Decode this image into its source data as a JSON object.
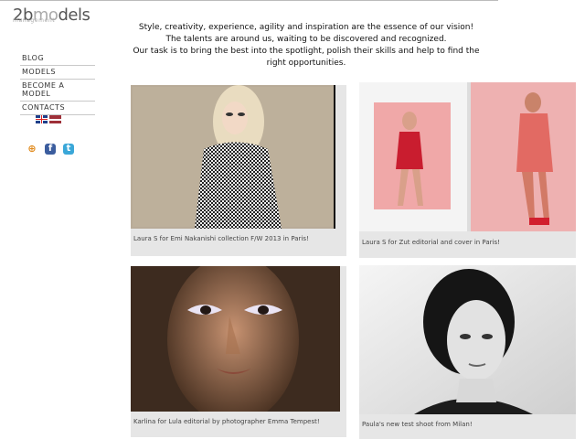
{
  "logo": {
    "part1": "2b",
    "part2": "mo",
    "part3": "dels",
    "sub": "management"
  },
  "nav": [
    {
      "label": "BLOG"
    },
    {
      "label": "MODELS"
    },
    {
      "label": "BECOME A MODEL"
    },
    {
      "label": "CONTACTS"
    }
  ],
  "flags": {
    "en": "uk-flag-icon",
    "lv": "latvia-flag-icon"
  },
  "social": {
    "d": "draugiem-icon",
    "f": "facebook-icon",
    "t": "twitter-icon"
  },
  "intro": {
    "line1": "Style, creativity, experience, agility and inspiration are the essence of our vision!",
    "line2": "The talents are around us, waiting to be discovered and recognized.",
    "line3": "Our task is to bring the best into the spotlight, polish their skills and help to find the right opportunities."
  },
  "posts": [
    {
      "caption": "Laura S for Emi Nakanishi collection F/W 2013 in Paris!"
    },
    {
      "caption": "Laura S for Zut editorial and cover in Paris!"
    },
    {
      "caption": "Karlina for Lula editorial by photographer Emma Tempest!"
    },
    {
      "caption": "Paula's new test shoot from Milan!"
    }
  ]
}
